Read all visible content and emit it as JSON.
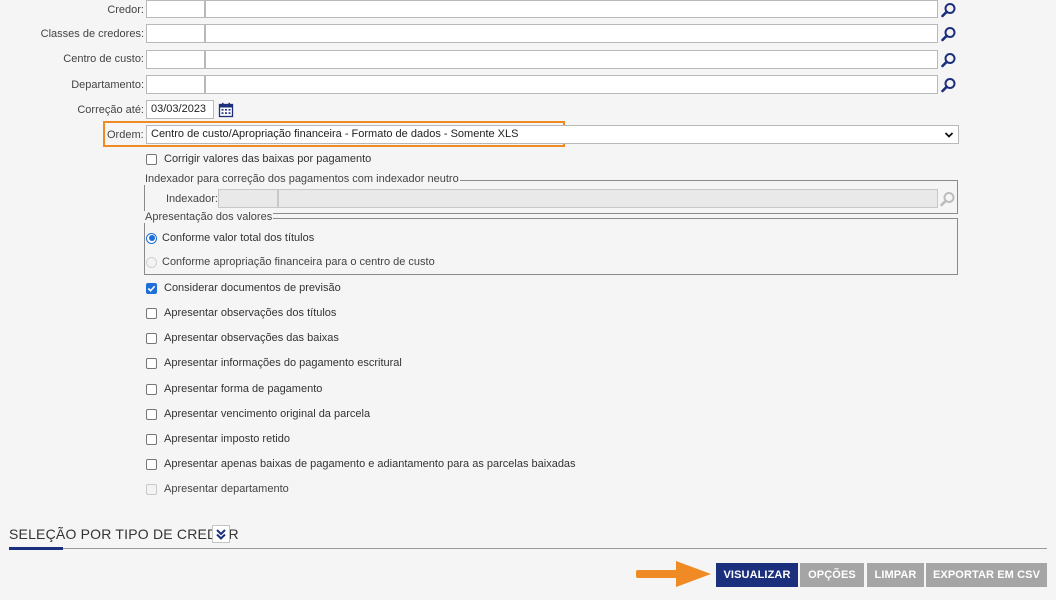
{
  "form": {
    "credor_label": "Credor:",
    "classes_label": "Classes de credores:",
    "centro_label": "Centro de custo:",
    "departamento_label": "Departamento:",
    "correcao_label": "Correção até:",
    "correcao_value": "03/03/2023",
    "ordem_label": "Ordem:",
    "ordem_value": "Centro de custo/Apropriação financeira - Formato de dados - Somente XLS"
  },
  "checkboxes": {
    "corrigir": "Corrigir valores das baixas por pagamento",
    "considerar": "Considerar documentos de previsão",
    "obs_titulos": "Apresentar observações dos títulos",
    "obs_baixas": "Apresentar observações das baixas",
    "info_pagamento": "Apresentar informações do pagamento escritural",
    "forma_pagamento": "Apresentar forma de pagamento",
    "vencimento": "Apresentar vencimento original da parcela",
    "imposto": "Apresentar imposto retido",
    "apenas_baixas": "Apresentar apenas baixas de pagamento e adiantamento para as parcelas baixadas",
    "departamento": "Apresentar departamento"
  },
  "indexador": {
    "legend": "Indexador para correção dos pagamentos com indexador neutro",
    "label": "Indexador:"
  },
  "apresentacao": {
    "legend": "Apresentação dos valores",
    "option1": "Conforme valor total dos títulos",
    "option2": "Conforme apropriação financeira para o centro de custo"
  },
  "section": {
    "title": "SELEÇÃO POR TIPO DE CREDOR"
  },
  "buttons": {
    "visualizar": "VISUALIZAR",
    "opcoes": "OPÇÕES",
    "limpar": "LIMPAR",
    "exportar": "EXPORTAR EM CSV"
  },
  "colors": {
    "primary": "#1b2f7c",
    "highlight": "#f08a24",
    "checkbox": "#1e6fd9"
  }
}
